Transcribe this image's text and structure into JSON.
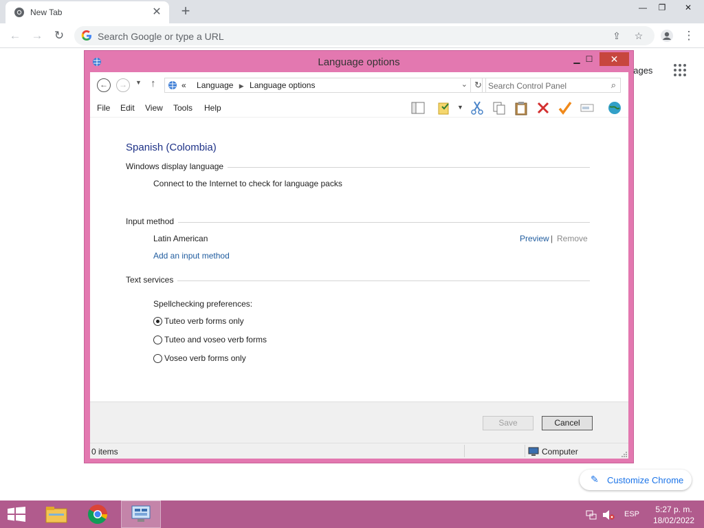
{
  "browser": {
    "tab_title": "New Tab",
    "tab_close": "✕",
    "new_tab": "+",
    "omnibox_placeholder": "Search Google or type a URL",
    "ntp_images": "nages",
    "customize_label": "Customize Chrome"
  },
  "dialog": {
    "title": "Language options",
    "breadcrumb_prefix": "«",
    "breadcrumbs": [
      "Language",
      "Language options"
    ],
    "search_placeholder": "Search Control Panel",
    "menu": [
      "File",
      "Edit",
      "View",
      "Tools",
      "Help"
    ],
    "heading": "Spanish (Colombia)",
    "display_language": {
      "label": "Windows display language",
      "text": "Connect to the Internet to check for language packs"
    },
    "input_method": {
      "label": "Input method",
      "item": "Latin American",
      "preview": "Preview",
      "separator": "|",
      "remove": "Remove",
      "add_link": "Add an input method"
    },
    "text_services": {
      "label": "Text services",
      "spell_label": "Spellchecking preferences:",
      "options": [
        {
          "label": "Tuteo verb forms only",
          "selected": true
        },
        {
          "label": "Tuteo and voseo verb forms",
          "selected": false
        },
        {
          "label": "Voseo verb forms only",
          "selected": false
        }
      ]
    },
    "buttons": {
      "save": "Save",
      "cancel": "Cancel"
    },
    "status": {
      "items": "0 items",
      "computer": "Computer"
    }
  },
  "taskbar": {
    "lang": "ESP",
    "time": "5:27 p. m.",
    "date": "18/02/2022"
  },
  "colors": {
    "window_frame": "#e378b0",
    "taskbar": "#b15b8d",
    "link": "#1e5b9e",
    "heading": "#1e3287",
    "close_button": "#c7463e"
  }
}
